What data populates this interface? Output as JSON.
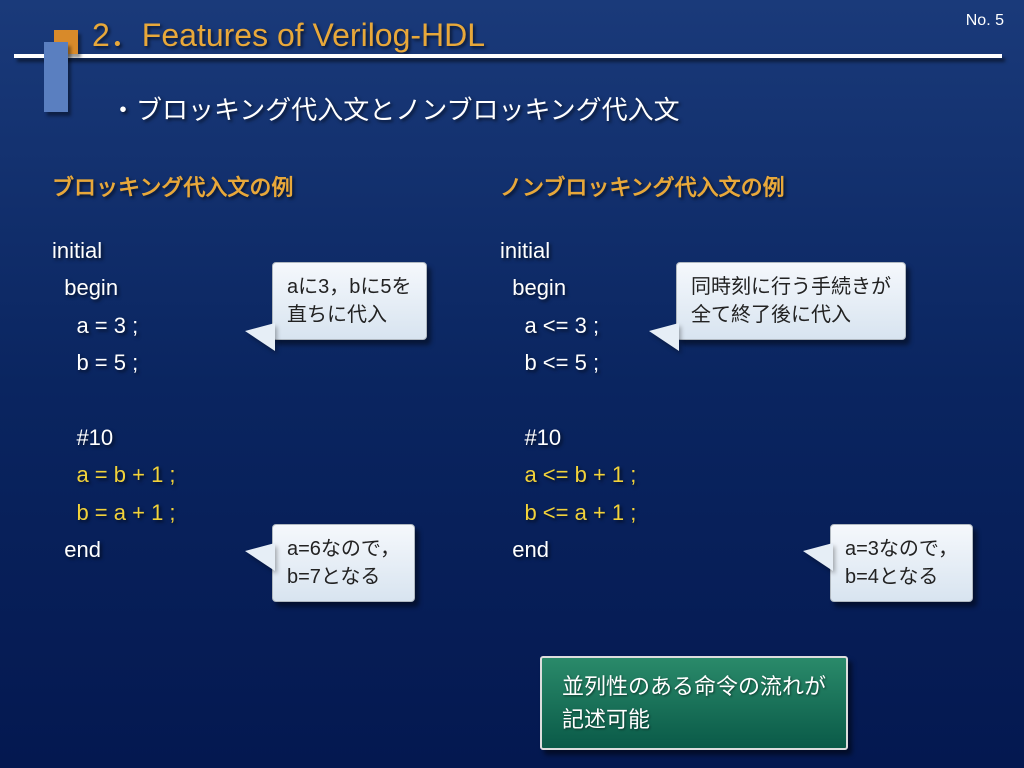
{
  "header": {
    "title": "2．Features of Verilog-HDL",
    "page": "No. 5"
  },
  "subtitle": "・ブロッキング代入文とノンブロッキング代入文",
  "left": {
    "heading": "ブロッキング代入文の例",
    "code": {
      "l1": "initial",
      "l2": "  begin",
      "l3": "    a = 3 ;",
      "l4": "    b = 5 ;",
      "l5": "",
      "l6": "    #10",
      "l7": "    a = b + 1 ;",
      "l8": "    b = a + 1 ;",
      "l9": "  end"
    }
  },
  "right": {
    "heading": "ノンブロッキング代入文の例",
    "code": {
      "l1": "initial",
      "l2": "  begin",
      "l3": "    a <= 3 ;",
      "l4": "    b <= 5 ;",
      "l5": "",
      "l6": "    #10",
      "l7": "    a <= b + 1 ;",
      "l8": "    b <= a + 1 ;",
      "l9": "  end"
    }
  },
  "callouts": {
    "c1a": "aに3，bに5を",
    "c1b": "直ちに代入",
    "c2a": "a=6なので，",
    "c2b": "b=7となる",
    "c3a": "同時刻に行う手続きが",
    "c3b": "全て終了後に代入",
    "c4a": "a=3なので，",
    "c4b": "b=4となる"
  },
  "greenbox": {
    "l1": "並列性のある命令の流れが",
    "l2": "記述可能"
  }
}
